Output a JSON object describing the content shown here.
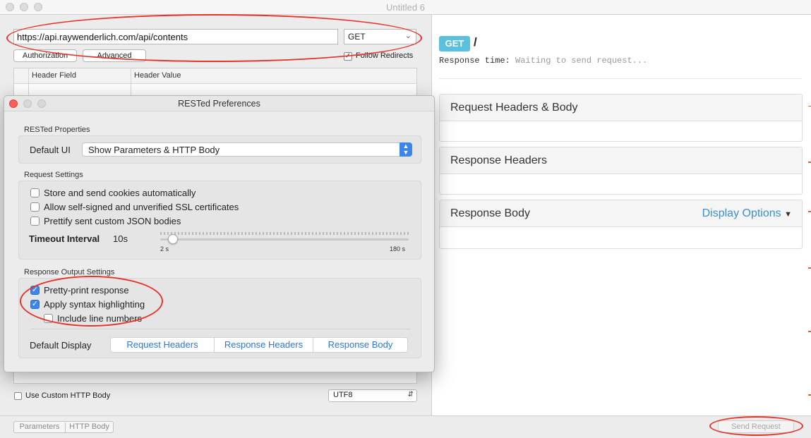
{
  "window": {
    "title": "Untitled 6"
  },
  "request": {
    "url": "https://api.raywenderlich.com/api/contents",
    "method": "GET",
    "tabs": [
      "Authorization",
      "Advanced"
    ],
    "follow_redirects_label": "Follow Redirects",
    "follow_redirects_checked": true,
    "table_headers": [
      "Header Field",
      "Header Value"
    ],
    "custom_body_label": "Use Custom HTTP Body",
    "encoding": "UTF8"
  },
  "bottom_bar": {
    "segments": [
      "Parameters",
      "HTTP Body"
    ],
    "send_label": "Send Request"
  },
  "response": {
    "method_badge": "GET",
    "path": "/",
    "time_label": "Response time:",
    "time_value": "Waiting to send request...",
    "panels": [
      "Request Headers & Body",
      "Response Headers",
      "Response Body"
    ],
    "display_options_label": "Display Options"
  },
  "prefs": {
    "title": "RESTed Preferences",
    "properties_label": "RESTed Properties",
    "default_ui_label": "Default UI",
    "default_ui_value": "Show Parameters & HTTP Body",
    "request_settings_label": "Request Settings",
    "request_options": [
      {
        "label": "Store and send cookies automatically",
        "checked": false
      },
      {
        "label": "Allow self-signed and unverified SSL certificates",
        "checked": false
      },
      {
        "label": "Prettify sent custom JSON bodies",
        "checked": false
      }
    ],
    "timeout_label": "Timeout Interval",
    "timeout_value": "10s",
    "timeout_min_label": "2 s",
    "timeout_max_label": "180 s",
    "timeout_fraction": 0.05,
    "response_settings_label": "Response Output Settings",
    "response_options": [
      {
        "label": "Pretty-print response",
        "checked": true
      },
      {
        "label": "Apply syntax highlighting",
        "checked": true
      },
      {
        "label": "Include line numbers",
        "checked": false
      }
    ],
    "default_display_label": "Default Display",
    "default_display_options": [
      "Request Headers",
      "Response Headers",
      "Response Body"
    ]
  },
  "colors": {
    "accent": "#3b86e8",
    "badge": "#5bc0de",
    "annotation": "#e6332a",
    "link": "#3a8fd1"
  }
}
